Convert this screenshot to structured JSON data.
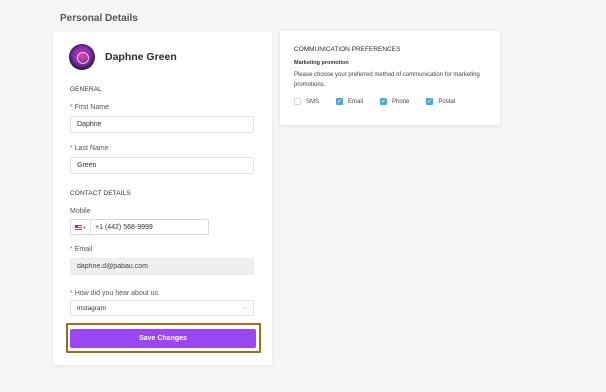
{
  "page": {
    "title": "Personal Details"
  },
  "profile": {
    "name": "Daphne Green"
  },
  "general": {
    "heading": "GENERAL",
    "first_name": {
      "label": "First Name",
      "value": "Daphne",
      "required": true
    },
    "last_name": {
      "label": "Last Name",
      "value": "Green",
      "required": true
    }
  },
  "contact": {
    "heading": "CONTACT DETAILS",
    "mobile": {
      "label": "Mobile",
      "country": "US",
      "value": "+1 (442) 568-9999"
    },
    "email": {
      "label": "Email",
      "value": "daphne.d@pabau.com",
      "required": true,
      "disabled": true
    }
  },
  "referral": {
    "label": "How did you hear about us",
    "value": "Instagram",
    "required": true
  },
  "actions": {
    "save_label": "Save Changes",
    "save_color": "#9b46f3"
  },
  "communication": {
    "title": "COMMUNICATION PREFERENCES",
    "subtitle": "Marketing promotion",
    "description": "Please choose your preferred method of communication for marketing promotions.",
    "options": [
      {
        "label": "SMS",
        "checked": false
      },
      {
        "label": "Email",
        "checked": true
      },
      {
        "label": "Phone",
        "checked": true
      },
      {
        "label": "Postal",
        "checked": true
      }
    ],
    "check_color": "#4aa9dc"
  }
}
